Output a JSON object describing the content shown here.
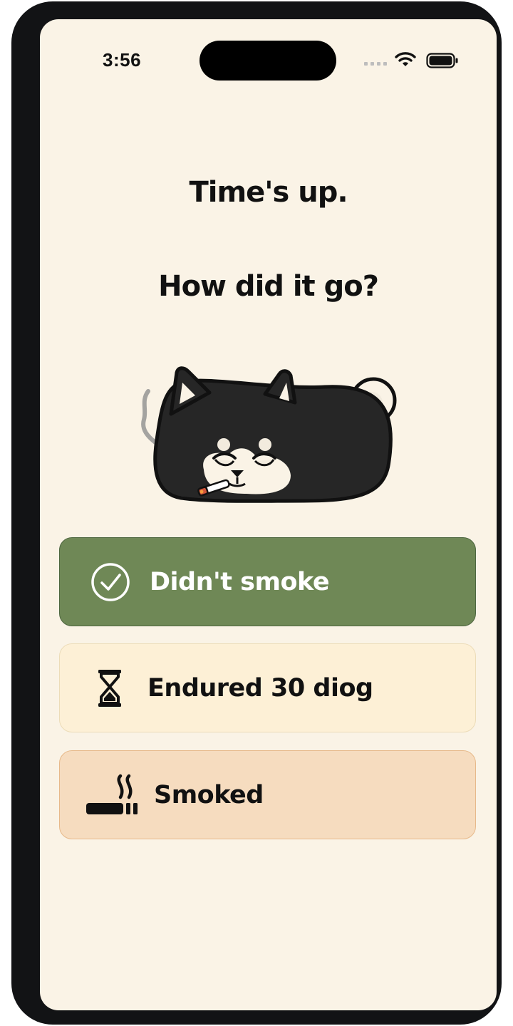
{
  "status_bar": {
    "time": "3:56"
  },
  "heading": {
    "line1": "Time's up.",
    "line2": "How did it go?"
  },
  "mascot": {
    "icon": "smoking-dog-mascot"
  },
  "options": [
    {
      "label": "Didn't smoke",
      "icon": "check-circle-icon",
      "color": "#6f8856"
    },
    {
      "label": "Endured 30 diog",
      "icon": "hourglass-icon",
      "color": "#fdf0d6"
    },
    {
      "label": "Smoked",
      "icon": "cigarette-icon",
      "color": "#f6dcbf"
    }
  ],
  "colors": {
    "background": "#faf3e6",
    "frame": "#121315"
  }
}
